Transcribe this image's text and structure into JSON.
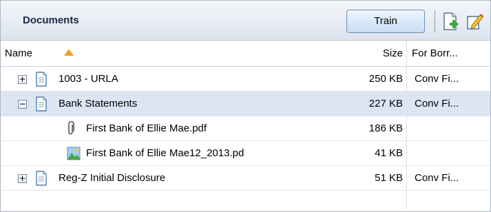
{
  "header": {
    "title": "Documents",
    "train_label": "Train",
    "icons": [
      "add-document-icon",
      "edit-icon"
    ]
  },
  "columns": {
    "name": "Name",
    "size": "Size",
    "for_borrower": "For Borr..."
  },
  "rows": [
    {
      "name": "1003 - URLA",
      "size": "250 KB",
      "for_borrower": "Conv Fi...",
      "type": "folder",
      "expander": "+",
      "icon": "document-icon"
    },
    {
      "name": "Bank Statements",
      "size": "227 KB",
      "for_borrower": "Conv Fi...",
      "type": "folder",
      "expander": "−",
      "icon": "document-icon",
      "selected": true
    },
    {
      "name": "First Bank of Ellie Mae.pdf",
      "size": "186 KB",
      "for_borrower": "",
      "type": "file",
      "icon": "paperclip-icon"
    },
    {
      "name": "First Bank of Ellie Mae12_2013.pd",
      "size": "41 KB",
      "for_borrower": "",
      "type": "file",
      "icon": "image-icon"
    },
    {
      "name": "Reg-Z Initial Disclosure",
      "size": "51 KB",
      "for_borrower": "Conv Fi...",
      "type": "folder",
      "expander": "+",
      "icon": "document-icon"
    }
  ],
  "colors": {
    "selected_row": "#dce6f3",
    "sort_arrow": "#f0a020",
    "header_text": "#1b2a44"
  }
}
